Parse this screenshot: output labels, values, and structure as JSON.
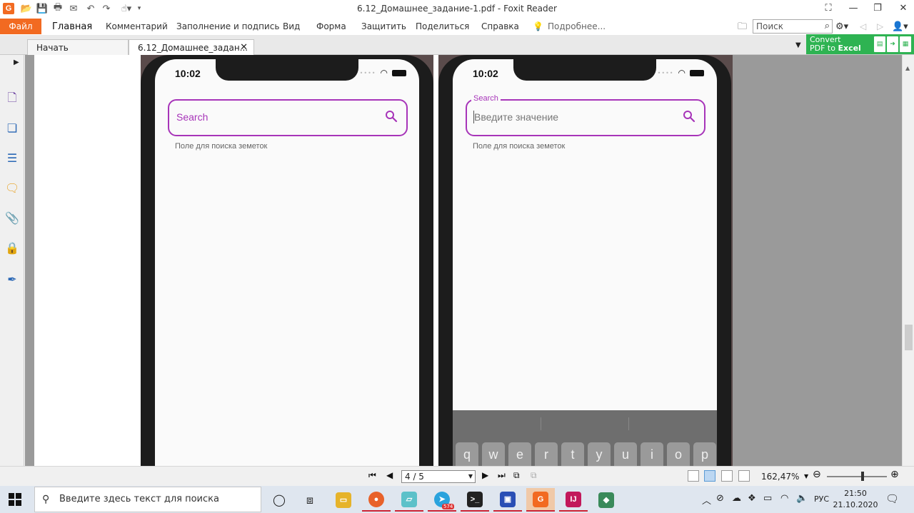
{
  "titlebar": {
    "title": "6.12_Домашнее_задание-1.pdf - Foxit Reader",
    "app_icon": "G"
  },
  "ribbon": {
    "file_label": "Файл",
    "menu": [
      "Главная",
      "Комментарий",
      "Заполнение и подпись",
      "Вид",
      "Форма",
      "Защитить",
      "Поделиться",
      "Справка"
    ],
    "tell_me": "Подробнее...",
    "search_placeholder": "Поиск"
  },
  "tabs": {
    "start": "Начать",
    "document": "6.12_Домашнее_задан..."
  },
  "convert": {
    "line1": "Convert",
    "line2_prefix": "PDF to ",
    "line2_bold": "Excel"
  },
  "phone_left": {
    "time": "10:02",
    "field_placeholder": "Search",
    "helper": "Поле для поиска земеток"
  },
  "phone_right": {
    "time": "10:02",
    "floating_label": "Search",
    "field_hint": "Введите значение",
    "helper": "Поле для поиска земеток",
    "keys": [
      "q",
      "w",
      "e",
      "r",
      "t",
      "y",
      "u",
      "i",
      "o",
      "p"
    ]
  },
  "statusbar": {
    "page_value": "4 / 5",
    "zoom": "162,47%"
  },
  "taskbar": {
    "search_placeholder": "Введите здесь текст для поиска",
    "telegram_badge": "574",
    "language": "РУС",
    "time": "21:50",
    "date": "21.10.2020"
  },
  "colors": {
    "foxit_orange": "#f26a21",
    "field_purple": "#a734b9",
    "convert_green": "#2eb352"
  }
}
